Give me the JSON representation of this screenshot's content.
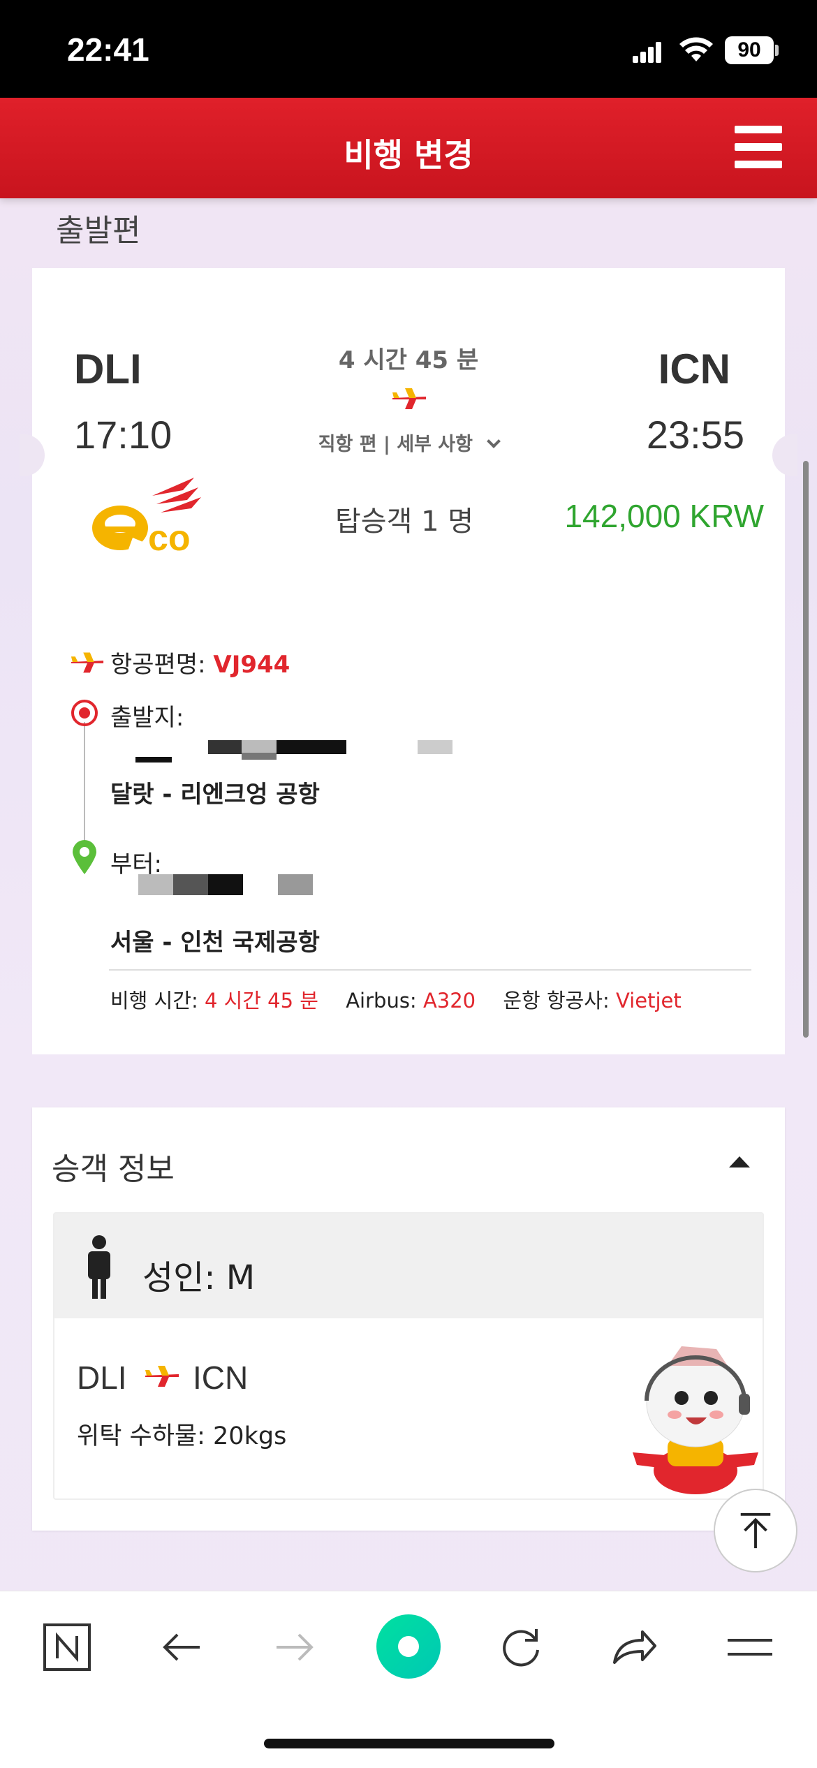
{
  "status_bar": {
    "time": "22:41",
    "battery": "90"
  },
  "header": {
    "title": "비행 변경"
  },
  "section_label": "출발편",
  "flight": {
    "origin_code": "DLI",
    "origin_time": "17:10",
    "dest_code": "ICN",
    "dest_time": "23:55",
    "duration": "4 시간 45 분",
    "direct_details": "직항 편 | 세부 사항",
    "passengers": "탑승객 1 명",
    "price": "142,000 KRW",
    "flight_no_label": "항공편명:",
    "flight_no": "VJ944",
    "depart_label": "출발지:",
    "depart_airport": "달랏 - 리엔크엉 공항",
    "arrive_label": "부터:",
    "arrive_airport": "서울 - 인천 국제공항",
    "flight_time_label": "비행 시간:",
    "flight_time": "4 시간 45 분",
    "aircraft_label": "Airbus:",
    "aircraft": "A320",
    "operator_label": "운항 항공사:",
    "operator": "Vietjet"
  },
  "passenger_info": {
    "title": "승객 정보",
    "adult_label": "성인: M",
    "route_from": "DLI",
    "route_to": "ICN",
    "baggage": "위탁 수하물: 20kgs"
  },
  "colors": {
    "brand_red": "#e1262d",
    "price_green": "#2fa52f",
    "accent_yellow": "#f5b400"
  },
  "icons": [
    "plane-icon",
    "hamburger-icon",
    "origin-dot-icon",
    "location-pin-icon",
    "person-icon",
    "scroll-top-icon",
    "back-icon",
    "forward-icon",
    "reload-icon",
    "share-icon",
    "menu-icon"
  ]
}
